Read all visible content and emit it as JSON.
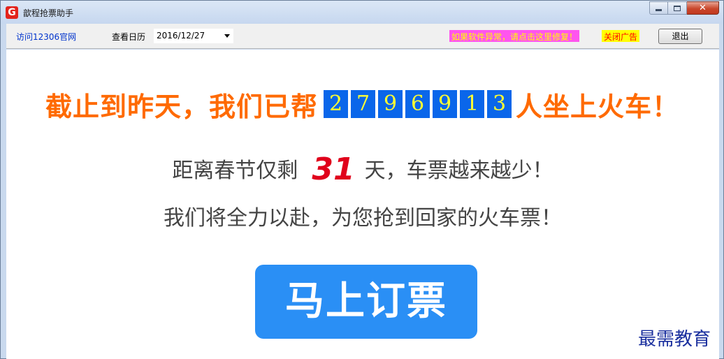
{
  "window": {
    "icon_glyph": "G",
    "title": "歆程抢票助手"
  },
  "toolbar": {
    "visit_link": "访问12306官网",
    "calendar_label": "查看日历",
    "date_value": "2016/12/27",
    "repair_link": "如果软件异常，请点击这里修复！",
    "close_ad": "关闭广告",
    "exit_label": "退出"
  },
  "headline": {
    "prefix": "截止到昨天，我们已帮",
    "digits": [
      "2",
      "7",
      "9",
      "6",
      "9",
      "1",
      "3"
    ],
    "suffix": "人坐上火车！"
  },
  "countdown": {
    "prefix": "距离春节仅剩",
    "days": "31",
    "suffix": "天，车票越来越少！"
  },
  "slogan": "我们将全力以赴，为您抢到回家的火车票！",
  "book_button": "马上订票",
  "watermark": "最需教育",
  "colors": {
    "headline": "#ff6a00",
    "digit_bg": "#0a66ea",
    "digit_text": "#ffff33",
    "days": "#e0001b",
    "button": "#2a8ff5",
    "repair_bg": "#ff55ee",
    "close_ad_bg": "#ffff00"
  }
}
